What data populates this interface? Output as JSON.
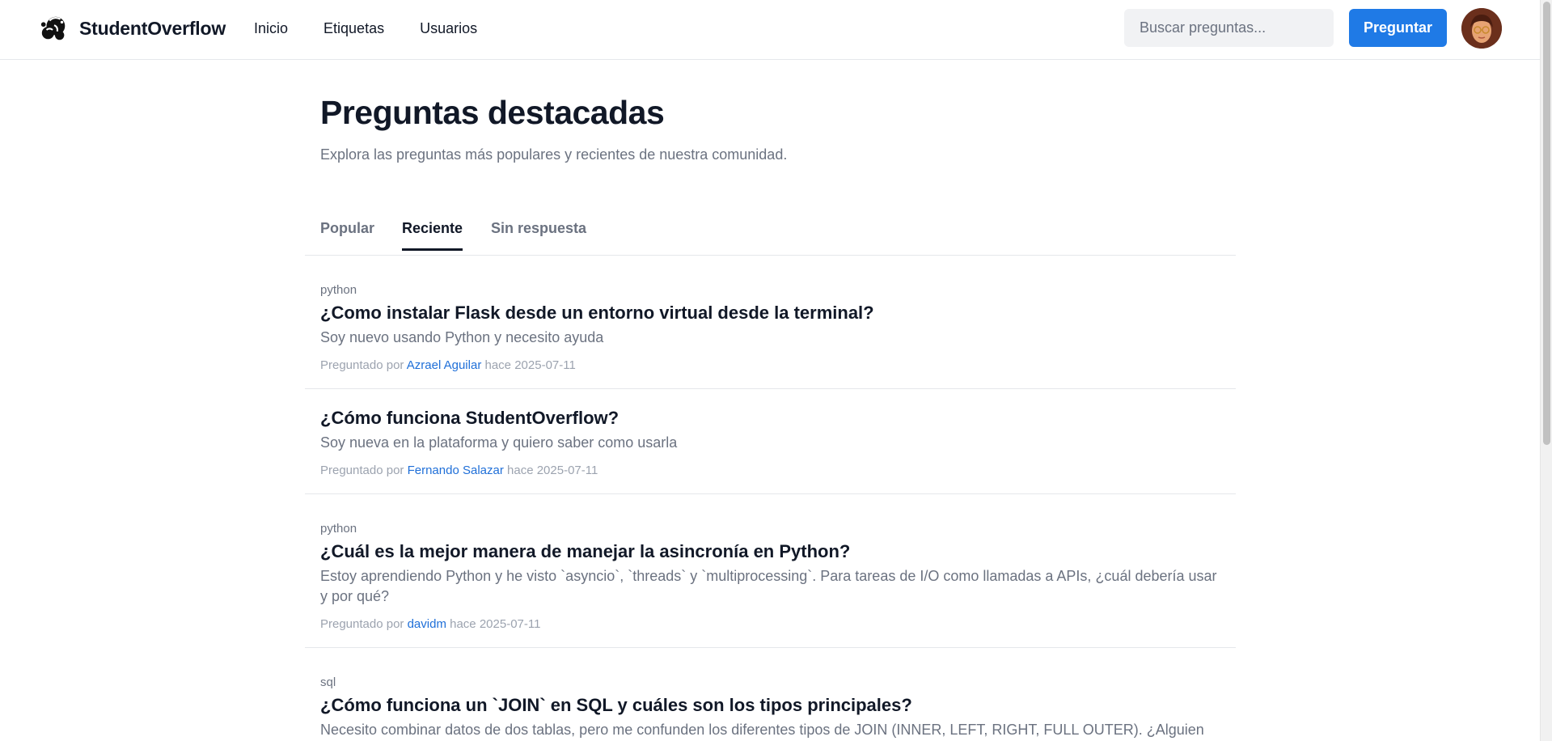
{
  "header": {
    "brand": "StudentOverflow",
    "nav": [
      "Inicio",
      "Etiquetas",
      "Usuarios"
    ],
    "search_placeholder": "Buscar preguntas...",
    "ask_label": "Preguntar",
    "avatar_icon": "user-avatar"
  },
  "main": {
    "title": "Preguntas destacadas",
    "subtitle": "Explora las preguntas más populares y recientes de nuestra comunidad.",
    "tabs": [
      "Popular",
      "Reciente",
      "Sin respuesta"
    ],
    "active_tab": "Reciente"
  },
  "questions": [
    {
      "tag": "python",
      "title": "¿Como instalar Flask desde un entorno virtual desde la terminal?",
      "excerpt": "Soy nuevo usando Python y necesito ayuda",
      "asked_prefix": "Preguntado por",
      "author": "Azrael Aguilar",
      "ago_prefix": "hace",
      "date": "2025-07-11"
    },
    {
      "tag": "",
      "title": "¿Cómo funciona StudentOverflow?",
      "excerpt": "Soy nueva en la plataforma y quiero saber como usarla",
      "asked_prefix": "Preguntado por",
      "author": "Fernando Salazar",
      "ago_prefix": "hace",
      "date": "2025-07-11"
    },
    {
      "tag": "python",
      "title": "¿Cuál es la mejor manera de manejar la asincronía en Python?",
      "excerpt": "Estoy aprendiendo Python y he visto `asyncio`, `threads` y `multiprocessing`. Para tareas de I/O como llamadas a APIs, ¿cuál debería usar y por qué?",
      "asked_prefix": "Preguntado por",
      "author": "davidm",
      "ago_prefix": "hace",
      "date": "2025-07-11"
    },
    {
      "tag": "sql",
      "title": "¿Cómo funciona un `JOIN` en SQL y cuáles son los tipos principales?",
      "excerpt": "Necesito combinar datos de dos tablas, pero me confunden los diferentes tipos de JOIN (INNER, LEFT, RIGHT, FULL OUTER). ¿Alguien podría explicarlo con un ejemplo simple?",
      "asked_prefix": "",
      "author": "",
      "ago_prefix": "",
      "date": ""
    }
  ],
  "colors": {
    "accent": "#1f7ae6",
    "link": "#1f6fd8",
    "muted": "#6b7280",
    "text": "#111827"
  }
}
